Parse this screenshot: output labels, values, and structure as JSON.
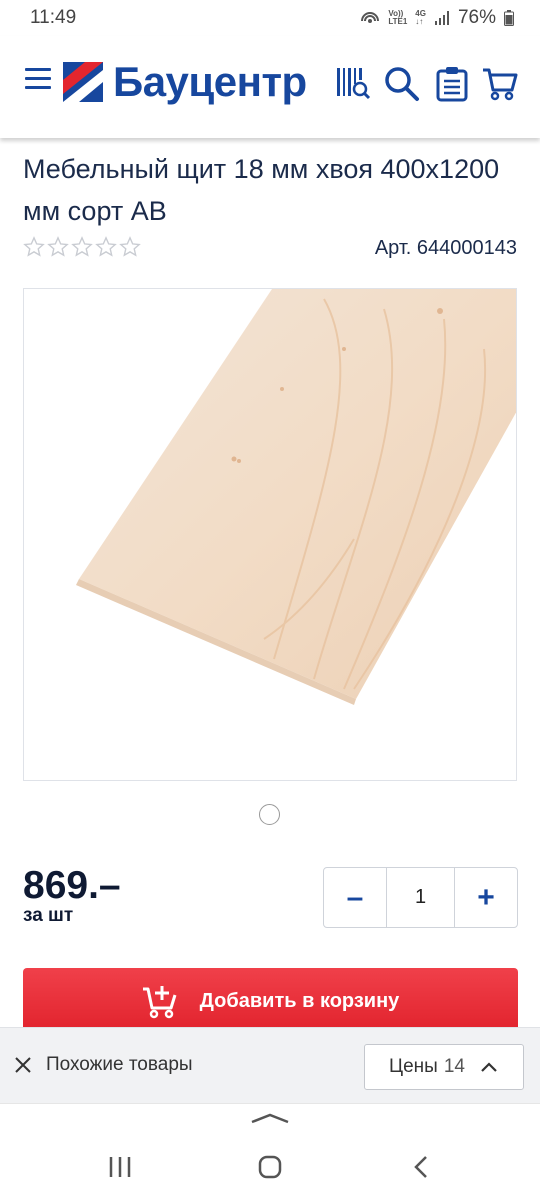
{
  "status": {
    "time": "11:49",
    "net_top": "Vo))",
    "net_bottom": "LTE1",
    "net_type": "4G",
    "battery": "76%"
  },
  "header": {
    "brand": "Бауцентр",
    "brand_color": "#17479e",
    "icons": [
      "menu-icon",
      "barcode-search-icon",
      "search-icon",
      "clipboard-list-icon",
      "cart-icon"
    ]
  },
  "product": {
    "title": "Мебельный щит 18 мм хвоя 400х1200 мм сорт АВ",
    "article": "Арт. 644000143",
    "rating": 0,
    "rating_max": 5,
    "image": "pine-board",
    "gallery_count": 1,
    "gallery_index": 1
  },
  "price": {
    "value": "869.–",
    "unit": "за шт"
  },
  "quantity": {
    "minus": "–",
    "value": "1",
    "plus": "+"
  },
  "add_to_cart": {
    "label": "Добавить в корзину",
    "color": "#e8303a"
  },
  "bottom_bar": {
    "similar_label": "Похожие товары",
    "prices_label": "Цены",
    "prices_count": "14"
  },
  "system_nav": [
    "recent-apps",
    "home",
    "back"
  ]
}
